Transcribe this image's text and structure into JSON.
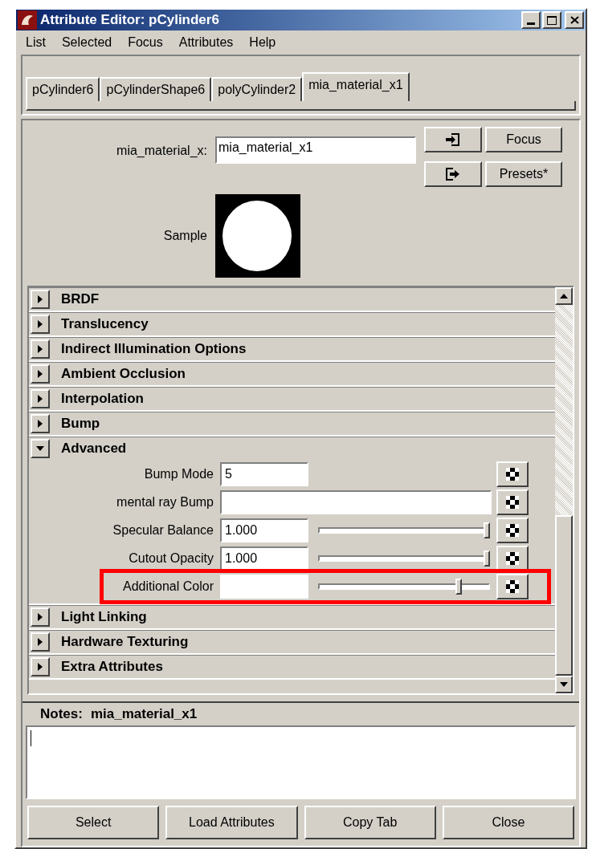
{
  "window": {
    "title": "Attribute Editor: pCylinder6"
  },
  "menu": [
    "List",
    "Selected",
    "Focus",
    "Attributes",
    "Help"
  ],
  "tabs": [
    {
      "label": "pCylinder6",
      "selected": false
    },
    {
      "label": "pCylinderShape6",
      "selected": false
    },
    {
      "label": "polyCylinder2",
      "selected": false
    },
    {
      "label": "mia_material_x1",
      "selected": true
    }
  ],
  "node": {
    "label": "mia_material_x:",
    "value": "mia_material_x1",
    "buttons": [
      "Focus",
      "Presets*"
    ]
  },
  "sample": {
    "label": "Sample"
  },
  "sections": [
    {
      "title": "BRDF",
      "expanded": false
    },
    {
      "title": "Translucency",
      "expanded": false
    },
    {
      "title": "Indirect Illumination Options",
      "expanded": false
    },
    {
      "title": "Ambient Occlusion",
      "expanded": false
    },
    {
      "title": "Interpolation",
      "expanded": false
    },
    {
      "title": "Bump",
      "expanded": false
    },
    {
      "title": "Advanced",
      "expanded": true,
      "attributes": [
        {
          "kind": "field",
          "label": "Bump Mode",
          "value": "5",
          "highlighted": false
        },
        {
          "kind": "wide",
          "label": "mental ray Bump",
          "highlighted": false
        },
        {
          "kind": "slider",
          "label": "Specular Balance",
          "value": "1.000",
          "level": 1,
          "highlighted": false
        },
        {
          "kind": "slider",
          "label": "Cutout Opacity",
          "value": "1.000",
          "level": 1,
          "highlighted": false
        },
        {
          "kind": "color",
          "label": "Additional Color",
          "color": "#ffffff",
          "level": 0.83,
          "highlighted": true
        }
      ]
    },
    {
      "title": "Light Linking",
      "expanded": false
    },
    {
      "title": "Hardware Texturing",
      "expanded": false
    },
    {
      "title": "Extra Attributes",
      "expanded": false
    }
  ],
  "notes": {
    "label": "Notes:",
    "node": "mia_material_x1"
  },
  "buttons": [
    "Select",
    "Load Attributes",
    "Copy Tab",
    "Close"
  ]
}
